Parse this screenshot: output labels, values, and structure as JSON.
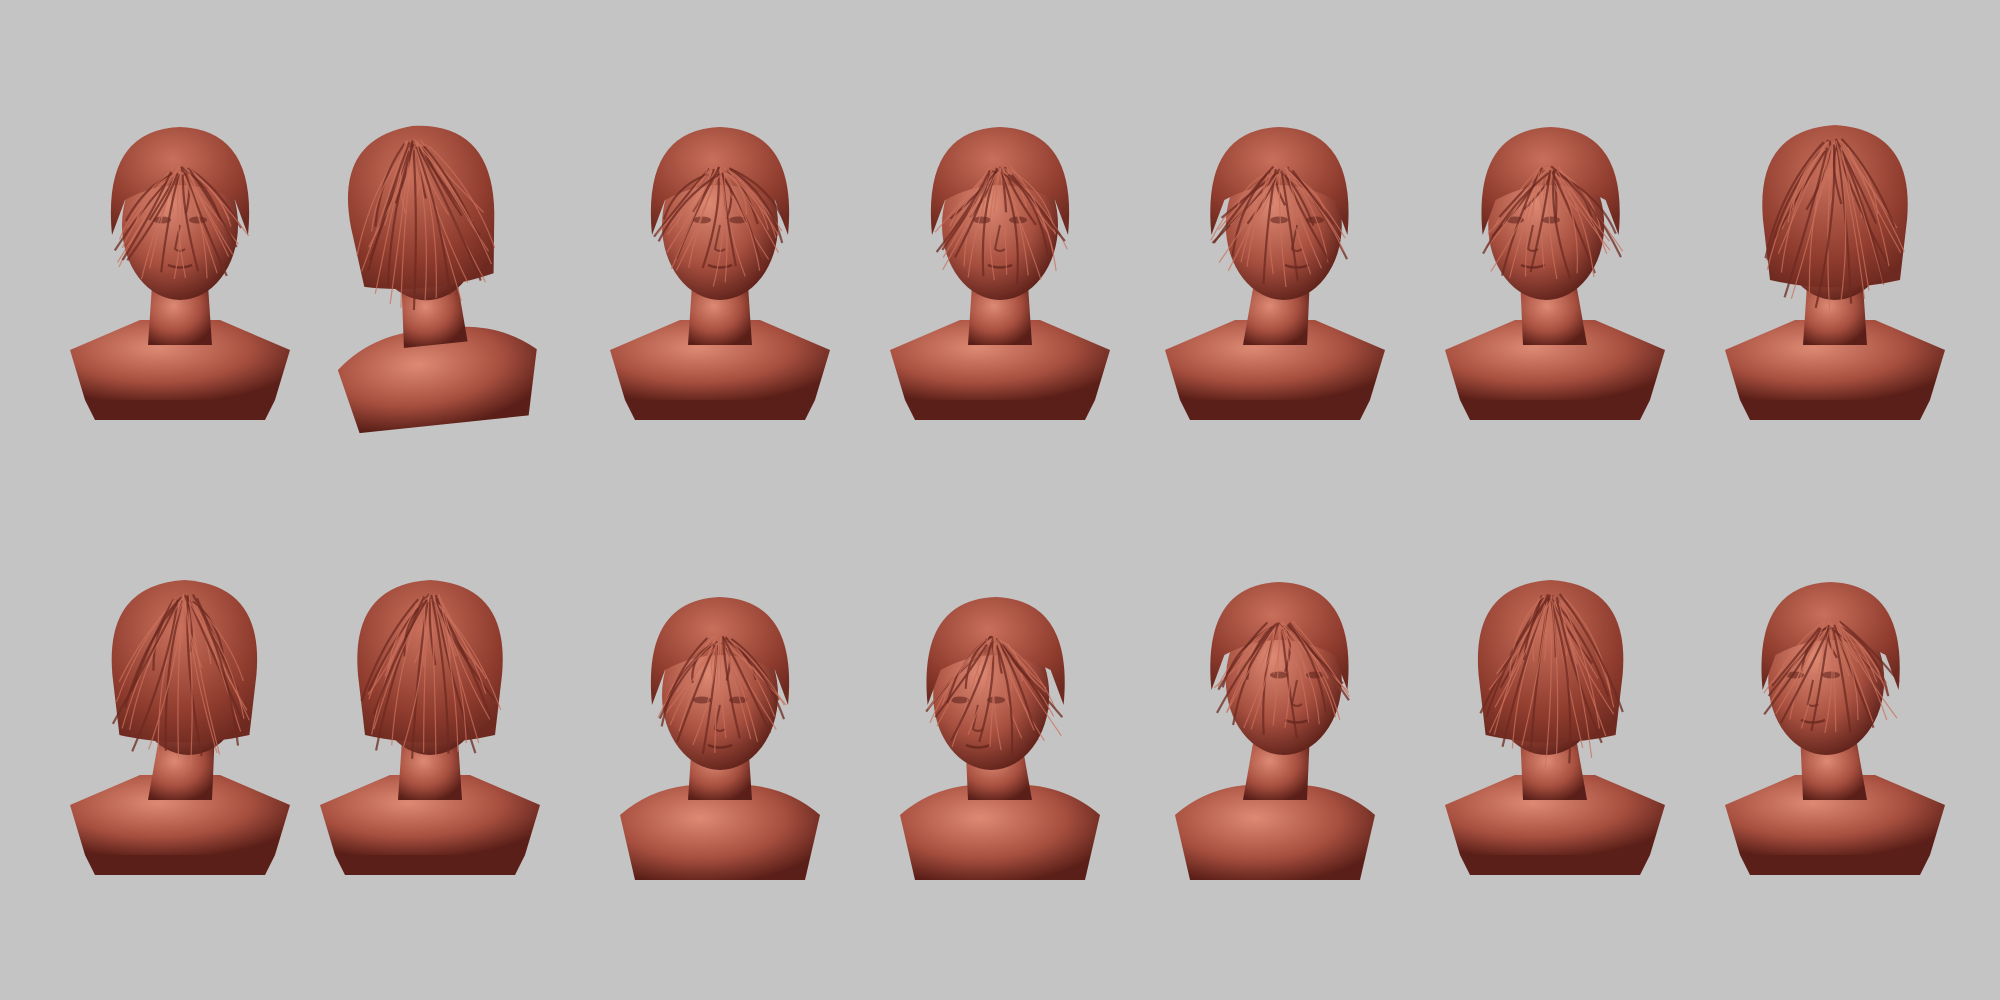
{
  "background_color": "#c4c4c4",
  "clay_colors": {
    "base": "#a85040",
    "light": "#c9705c",
    "highlight": "#dd8a74",
    "hair": "#8f3c2e",
    "hair_dark": "#6e2a20",
    "shadow": "#5a1f18"
  },
  "views": [
    {
      "row": 1,
      "pose": "front",
      "pedestal": true,
      "tilt": 0
    },
    {
      "row": 1,
      "pose": "back-top",
      "pedestal": false,
      "tilt": -6
    },
    {
      "row": 1,
      "pose": "front",
      "pedestal": true,
      "tilt": 0
    },
    {
      "row": 1,
      "pose": "front",
      "pedestal": true,
      "tilt": 0
    },
    {
      "row": 1,
      "pose": "right-back",
      "pedestal": true,
      "tilt": 0
    },
    {
      "row": 1,
      "pose": "left-three-quarter",
      "pedestal": true,
      "tilt": 0
    },
    {
      "row": 1,
      "pose": "back",
      "pedestal": true,
      "tilt": 0
    },
    {
      "row": 2,
      "pose": "back-right",
      "pedestal": true,
      "tilt": 0
    },
    {
      "row": 2,
      "pose": "back",
      "pedestal": true,
      "tilt": 0
    },
    {
      "row": 2,
      "pose": "front-down",
      "pedestal": false,
      "tilt": 0
    },
    {
      "row": 2,
      "pose": "left-down",
      "pedestal": false,
      "tilt": 0
    },
    {
      "row": 2,
      "pose": "right",
      "pedestal": false,
      "tilt": 0
    },
    {
      "row": 2,
      "pose": "back-left",
      "pedestal": true,
      "tilt": 0
    },
    {
      "row": 2,
      "pose": "left",
      "pedestal": true,
      "tilt": 0
    }
  ]
}
